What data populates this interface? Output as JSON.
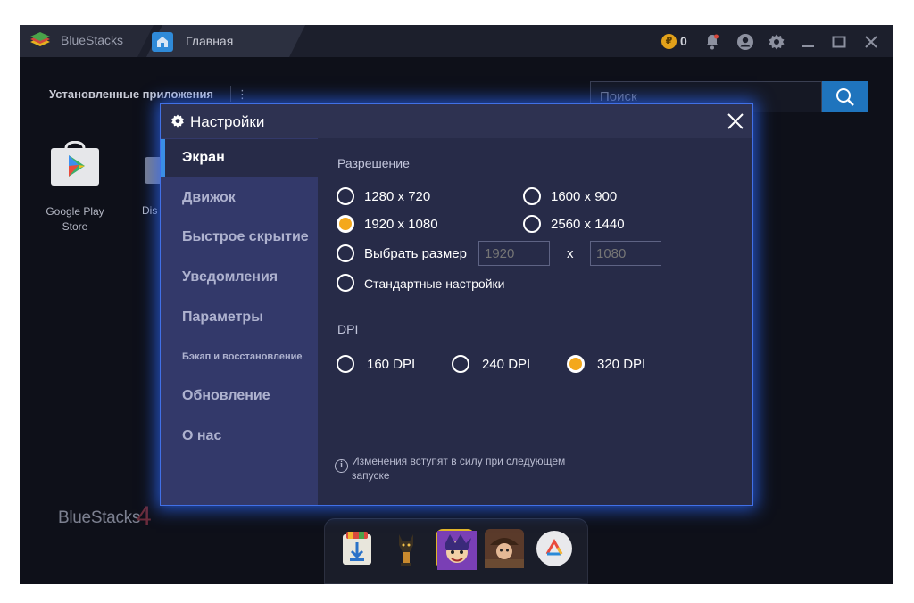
{
  "titlebar": {
    "app_name": "BlueStacks",
    "tab_home": "Главная",
    "coins": "0"
  },
  "home": {
    "installed_apps": "Установленные приложения",
    "kebab": "⋮",
    "search_placeholder": "Поиск",
    "apps": [
      {
        "label": "Google Play Store"
      },
      {
        "label": "Dis"
      }
    ],
    "brand": "BlueStacks",
    "brand_version": "4"
  },
  "dialog": {
    "title": "Настройки",
    "sidebar": [
      {
        "label": "Экран",
        "active": true
      },
      {
        "label": "Движок"
      },
      {
        "label": "Быстрое скрытие"
      },
      {
        "label": "Уведомления"
      },
      {
        "label": "Параметры"
      },
      {
        "label": "Бэкап и восстановление"
      },
      {
        "label": "Обновление"
      },
      {
        "label": "О нас"
      }
    ],
    "resolution": {
      "label": "Разрешение",
      "options": [
        {
          "label": "1280 x 720",
          "checked": false
        },
        {
          "label": "1600 x 900",
          "checked": false
        },
        {
          "label": "1920 x 1080",
          "checked": true
        },
        {
          "label": "2560 x 1440",
          "checked": false
        }
      ],
      "custom_label": "Выбрать размер",
      "custom_width_placeholder": "1920",
      "custom_height_placeholder": "1080",
      "times": "x",
      "default_label": "Стандартные настройки"
    },
    "dpi": {
      "label": "DPI",
      "options": [
        {
          "label": "160 DPI",
          "checked": false
        },
        {
          "label": "240 DPI",
          "checked": false
        },
        {
          "label": "320 DPI",
          "checked": true
        }
      ]
    },
    "info_text": "Изменения вступят в силу при следующем запуске"
  },
  "colors": {
    "accent": "#f4a81c",
    "dialog_bg": "#272b48",
    "sidebar_bg": "#33396a",
    "glow": "#2c6aff"
  }
}
